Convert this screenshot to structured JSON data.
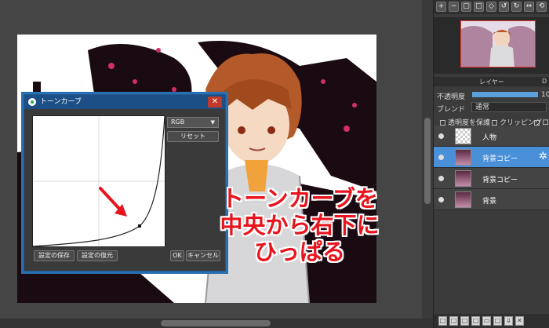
{
  "dialog": {
    "title": "トーンカーブ",
    "channel": "RGB",
    "reset_label": "リセット",
    "save_label": "設定の保存",
    "restore_label": "設定の復元",
    "ok_label": "OK",
    "cancel_label": "キャンセル",
    "close_glyph": "✕"
  },
  "annotation": {
    "lines": [
      "トーンカーブを",
      "中央から右下に",
      "ひっぱる"
    ],
    "color": "#e8141d"
  },
  "layers_panel": {
    "tab_label": "レイヤー",
    "opacity_label": "不透明度",
    "opacity_value": "10",
    "blend_label": "ブレンド",
    "blend_value": "通常",
    "protect_label": "透明度を保護",
    "clipping_label": "クリッピング",
    "lock_label": "ロッ",
    "selected_color": "#4a90d9",
    "layers": [
      {
        "name": "人物",
        "selected": false
      },
      {
        "name": "背景コピー",
        "selected": true
      },
      {
        "name": "背景コピー",
        "selected": false
      },
      {
        "name": "背景",
        "selected": false
      }
    ]
  },
  "icons": {
    "dialog": "tone-curve-app-icon",
    "arrow": "red-arrow-icon",
    "settings": "gear-icon"
  }
}
